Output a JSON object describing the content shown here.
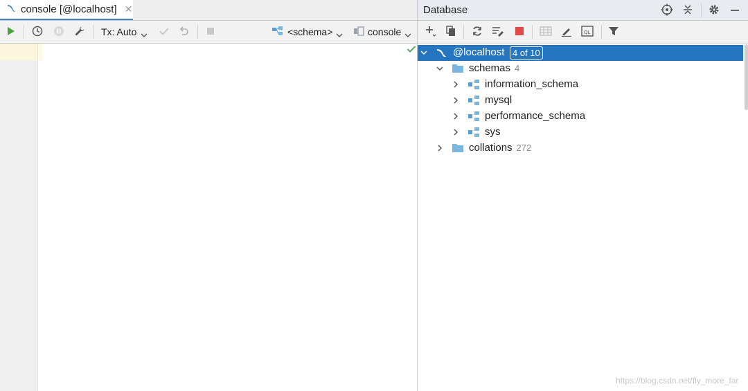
{
  "editor": {
    "tab": {
      "label": "console [@localhost]",
      "close_glyph": "✕"
    },
    "toolbar": {
      "tx_mode": "Tx: Auto",
      "schema_selector": "<schema>",
      "console_selector": "console"
    }
  },
  "database_panel": {
    "title": "Database",
    "tree": {
      "root": {
        "label": "@localhost",
        "badge": "4 of 10"
      },
      "schemas": {
        "label": "schemas",
        "count": "4"
      },
      "schema_items": [
        {
          "label": "information_schema"
        },
        {
          "label": "mysql"
        },
        {
          "label": "performance_schema"
        },
        {
          "label": "sys"
        }
      ],
      "collations": {
        "label": "collations",
        "count": "272"
      }
    }
  },
  "watermark": "https://blog.csdn.net/fly_more_far",
  "colors": {
    "accent": "#2675bf",
    "run_green": "#4aa23c",
    "stop_red": "#e24a4a",
    "folder_blue": "#7ab7e0",
    "check_green": "#59a869"
  },
  "icons": [
    "mysql-icon",
    "run-icon",
    "history-icon",
    "pause-icon",
    "wrench-icon",
    "check-icon",
    "undo-icon",
    "stop-icon",
    "schema-icon",
    "console-icon",
    "crosshair-icon",
    "collapse-icon",
    "gear-icon",
    "minimize-icon",
    "add-icon",
    "copy-icon",
    "refresh-icon",
    "edit-datasource-icon",
    "table-icon",
    "pencil-icon",
    "query-icon",
    "filter-icon",
    "folder-icon"
  ]
}
